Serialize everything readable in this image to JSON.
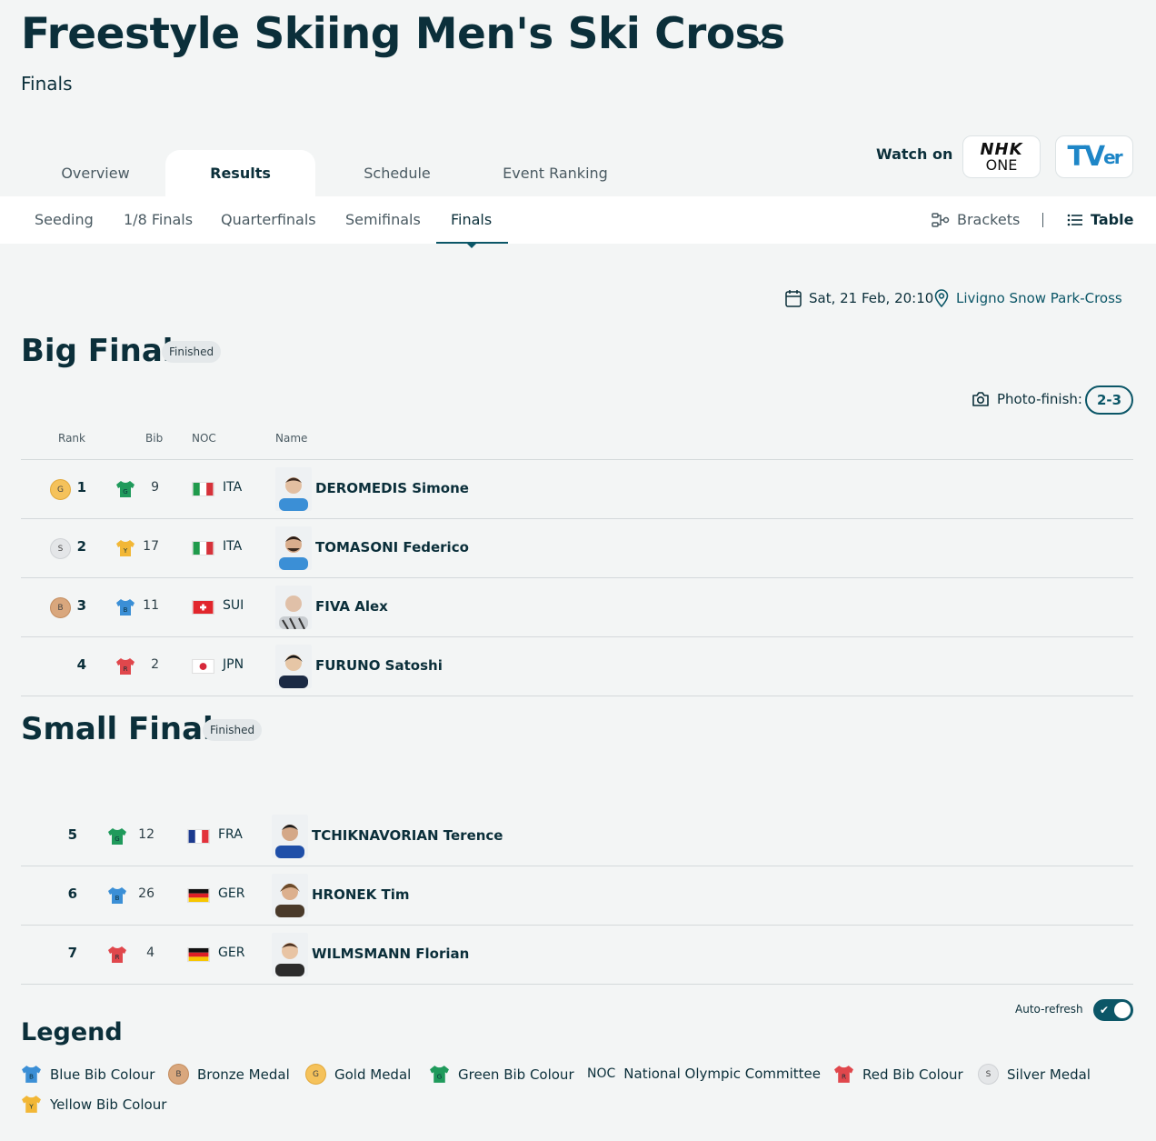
{
  "header": {
    "title": "Freestyle Skiing Men's Ski Cross",
    "subtitle": "Finals"
  },
  "tabs": [
    {
      "label": "Overview"
    },
    {
      "label": "Results"
    },
    {
      "label": "Schedule"
    },
    {
      "label": "Event Ranking"
    }
  ],
  "watch": {
    "label": "Watch on",
    "nhk_line1": "NHK",
    "nhk_line2": "ONE",
    "tver_main": "TV",
    "tver_tail": "er"
  },
  "subtabs": [
    {
      "label": "Seeding"
    },
    {
      "label": "1/8 Finals"
    },
    {
      "label": "Quarterfinals"
    },
    {
      "label": "Semifinals"
    },
    {
      "label": "Finals"
    }
  ],
  "view": {
    "brackets": "Brackets",
    "table": "Table"
  },
  "meta": {
    "date": "Sat, 21 Feb, 20:10",
    "venue": "Livigno Snow Park-Cross"
  },
  "big_final": {
    "title": "Big Final",
    "status": "Finished",
    "photo_finish_label": "Photo-finish:",
    "photo_finish_value": "2-3",
    "columns": {
      "rank": "Rank",
      "bib": "Bib",
      "noc": "NOC",
      "name": "Name"
    },
    "rows": [
      {
        "medal": "G",
        "rank": "1",
        "bib_color": "G",
        "bib": "9",
        "noc": "ITA",
        "name": "DEROMEDIS Simone"
      },
      {
        "medal": "S",
        "rank": "2",
        "bib_color": "Y",
        "bib": "17",
        "noc": "ITA",
        "name": "TOMASONI Federico"
      },
      {
        "medal": "B",
        "rank": "3",
        "bib_color": "B",
        "bib": "11",
        "noc": "SUI",
        "name": "FIVA Alex"
      },
      {
        "medal": "",
        "rank": "4",
        "bib_color": "R",
        "bib": "2",
        "noc": "JPN",
        "name": "FURUNO Satoshi"
      }
    ]
  },
  "small_final": {
    "title": "Small Final",
    "status": "Finished",
    "rows": [
      {
        "rank": "5",
        "bib_color": "G",
        "bib": "12",
        "noc": "FRA",
        "name": "TCHIKNAVORIAN Terence"
      },
      {
        "rank": "6",
        "bib_color": "B",
        "bib": "26",
        "noc": "GER",
        "name": "HRONEK Tim"
      },
      {
        "rank": "7",
        "bib_color": "R",
        "bib": "4",
        "noc": "GER",
        "name": "WILMSMANN Florian"
      }
    ]
  },
  "auto_refresh": {
    "label": "Auto-refresh",
    "on": true
  },
  "legend": {
    "title": "Legend",
    "items": [
      {
        "mark": "B",
        "label": "Blue Bib Colour"
      },
      {
        "mark": "B",
        "label": "Bronze Medal"
      },
      {
        "mark": "G",
        "label": "Gold Medal"
      },
      {
        "mark": "G",
        "label": "Green Bib Colour"
      },
      {
        "mark": "NOC",
        "label": "National Olympic Committee"
      },
      {
        "mark": "R",
        "label": "Red Bib Colour"
      },
      {
        "mark": "S",
        "label": "Silver Medal"
      },
      {
        "mark": "Y",
        "label": "Yellow Bib Colour"
      }
    ]
  },
  "colors": {
    "primary": "#0b2f3a",
    "accent": "#0b5667",
    "gold": "#f5c25b",
    "silver": "#e4e6e8",
    "bronze": "#d9a77d",
    "bib_green": "#1f9a5b",
    "bib_yellow": "#f2b736",
    "bib_blue": "#3b8fd6",
    "bib_red": "#e0474c"
  }
}
